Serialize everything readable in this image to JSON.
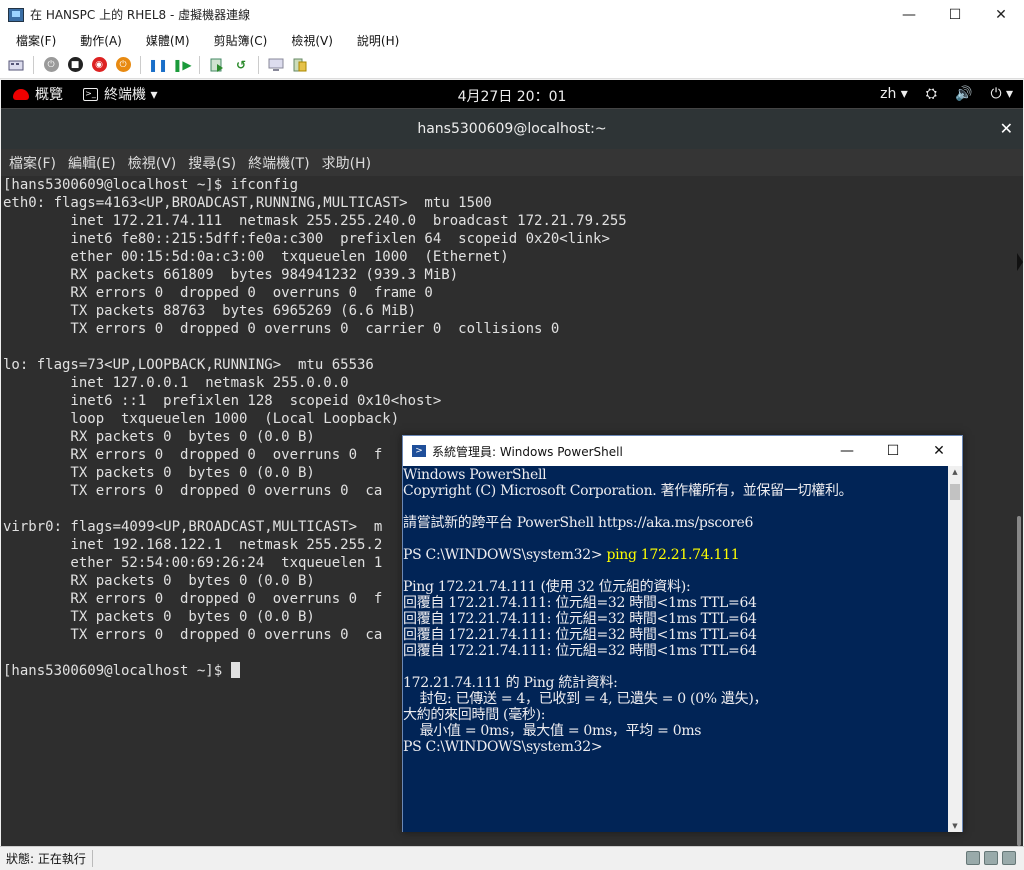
{
  "host_window": {
    "title": "在 HANSPC 上的 RHEL8 - 虛擬機器連線",
    "min": "—",
    "max": "☐",
    "close": "✕",
    "menu": [
      "檔案(F)",
      "動作(A)",
      "媒體(M)",
      "剪貼簿(C)",
      "檢視(V)",
      "說明(H)"
    ],
    "status": "狀態: 正在執行"
  },
  "gnome": {
    "activities": "概覽",
    "app": "終端機 ▾",
    "clock": "4月27日 20：01",
    "lang": "zh ▾",
    "tray": [
      "⛭",
      "🔊",
      "⏻ ▾"
    ]
  },
  "terminal": {
    "title": "hans5300609@localhost:~",
    "close": "✕",
    "menu": [
      "檔案(F)",
      "編輯(E)",
      "檢視(V)",
      "搜尋(S)",
      "終端機(T)",
      "求助(H)"
    ],
    "lines": [
      "[hans5300609@localhost ~]$ ifconfig",
      "eth0: flags=4163<UP,BROADCAST,RUNNING,MULTICAST>  mtu 1500",
      "        inet 172.21.74.111  netmask 255.255.240.0  broadcast 172.21.79.255",
      "        inet6 fe80::215:5dff:fe0a:c300  prefixlen 64  scopeid 0x20<link>",
      "        ether 00:15:5d:0a:c3:00  txqueuelen 1000  (Ethernet)",
      "        RX packets 661809  bytes 984941232 (939.3 MiB)",
      "        RX errors 0  dropped 0  overruns 0  frame 0",
      "        TX packets 88763  bytes 6965269 (6.6 MiB)",
      "        TX errors 0  dropped 0 overruns 0  carrier 0  collisions 0",
      "",
      "lo: flags=73<UP,LOOPBACK,RUNNING>  mtu 65536",
      "        inet 127.0.0.1  netmask 255.0.0.0",
      "        inet6 ::1  prefixlen 128  scopeid 0x10<host>",
      "        loop  txqueuelen 1000  (Local Loopback)",
      "        RX packets 0  bytes 0 (0.0 B)",
      "        RX errors 0  dropped 0  overruns 0  f",
      "        TX packets 0  bytes 0 (0.0 B)",
      "        TX errors 0  dropped 0 overruns 0  ca",
      "",
      "virbr0: flags=4099<UP,BROADCAST,MULTICAST>  m",
      "        inet 192.168.122.1  netmask 255.255.2",
      "        ether 52:54:00:69:26:24  txqueuelen 1",
      "        RX packets 0  bytes 0 (0.0 B)",
      "        RX errors 0  dropped 0  overruns 0  f",
      "        TX packets 0  bytes 0 (0.0 B)",
      "        TX errors 0  dropped 0 overruns 0  ca",
      ""
    ],
    "prompt": "[hans5300609@localhost ~]$ "
  },
  "powershell": {
    "title": "系統管理員: Windows PowerShell",
    "min": "—",
    "max": "☐",
    "close": "✕",
    "lines": [
      "Windows PowerShell",
      "Copyright (C) Microsoft Corporation. 著作權所有，並保留一切權利。",
      "",
      "請嘗試新的跨平台 PowerShell https://aka.ms/pscore6",
      "",
      "PS C:\\WINDOWS\\system32> "
    ],
    "command": "ping 172.21.74.111",
    "output": [
      "",
      "Ping 172.21.74.111 (使用 32 位元組的資料):",
      "回覆自 172.21.74.111: 位元組=32 時間<1ms TTL=64",
      "回覆自 172.21.74.111: 位元組=32 時間<1ms TTL=64",
      "回覆自 172.21.74.111: 位元組=32 時間<1ms TTL=64",
      "回覆自 172.21.74.111: 位元組=32 時間<1ms TTL=64",
      "",
      "172.21.74.111 的 Ping 統計資料:",
      "    封包: 已傳送 = 4，已收到 = 4, 已遺失 = 0 (0% 遺失)，",
      "大約的來回時間 (毫秒):",
      "    最小值 = 0ms，最大值 = 0ms，平均 = 0ms",
      "PS C:\\WINDOWS\\system32>"
    ]
  }
}
